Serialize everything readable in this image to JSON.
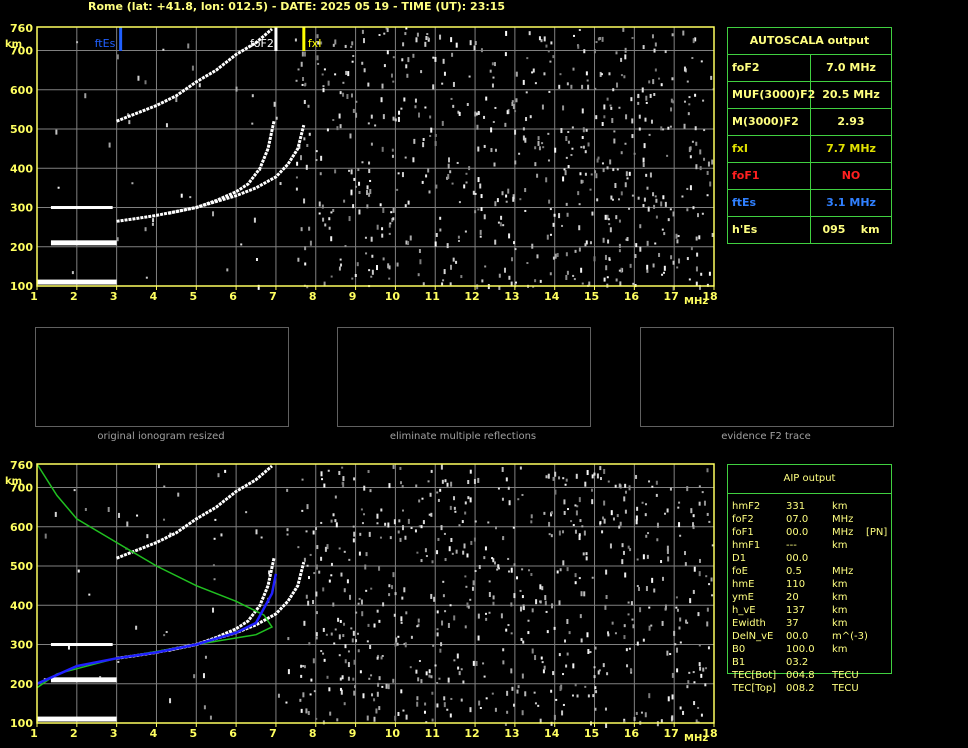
{
  "title": "Rome (lat: +41.8, lon: 012.5) - DATE: 2025 05 19 - TIME (UT): 23:15",
  "colors": {
    "axis": "#ffff60",
    "grid": "#808080",
    "ftEs": "#2060ff",
    "fxI": "#ffff00",
    "foF2": "#ffffff",
    "profile": "#20c020",
    "trace": "#2020ff",
    "foF1": "#ff2020"
  },
  "autoscala": {
    "header": "AUTOSCALA output",
    "rows": [
      {
        "k": "foF2",
        "v": "7.0 MHz",
        "c": "#ffff80"
      },
      {
        "k": "MUF(3000)F2",
        "v": "20.5 MHz",
        "c": "#ffff80"
      },
      {
        "k": "M(3000)F2",
        "v": "2.93",
        "c": "#ffff80"
      },
      {
        "k": "fxI",
        "v": "7.7 MHz",
        "c": "#e0e000"
      },
      {
        "k": "foF1",
        "v": "NO",
        "c": "#ff2020"
      },
      {
        "k": "ftEs",
        "v": "3.1 MHz",
        "c": "#3080ff"
      },
      {
        "k": "h'Es",
        "v": "095    km",
        "c": "#ffff80"
      }
    ]
  },
  "aip": {
    "header": "AIP output",
    "rows": [
      [
        "hmF2",
        "331",
        "km",
        ""
      ],
      [
        "foF2",
        "07.0",
        "MHz",
        ""
      ],
      [
        "foF1",
        "00.0",
        "MHz",
        "[PN]"
      ],
      [
        "hmF1",
        "---",
        "km",
        ""
      ],
      [
        "D1",
        "00.0",
        "",
        ""
      ],
      [
        "foE",
        "0.5",
        "MHz",
        ""
      ],
      [
        "hmE",
        "110",
        "km",
        ""
      ],
      [
        "ymE",
        "20",
        "km",
        ""
      ],
      [
        "h_vE",
        "137",
        "km",
        ""
      ],
      [
        "Ewidth",
        "37",
        "km",
        ""
      ],
      [
        "DelN_vE",
        "00.0",
        "m^(-3)",
        ""
      ],
      [
        "B0",
        "100.0",
        "km",
        ""
      ],
      [
        "B1",
        "03.2",
        "",
        ""
      ],
      [
        "TEC[Bot]",
        "004.8",
        "TECU",
        ""
      ],
      [
        "TEC[Top]",
        "008.2",
        "TECU",
        ""
      ]
    ]
  },
  "captions": [
    "original ionogram resized",
    "eliminate multiple reflections",
    "evidence F2 trace"
  ],
  "chart_data": [
    {
      "type": "scatter",
      "title": "",
      "xlabel": "MHz",
      "ylabel": "km",
      "xlim": [
        1,
        18
      ],
      "ylim": [
        100,
        760
      ],
      "xticks": [
        "1",
        "2",
        "3",
        "4",
        "5",
        "6",
        "7",
        "8",
        "9",
        "10",
        "11",
        "12",
        "13",
        "14",
        "15",
        "16",
        "17",
        "18"
      ],
      "yticks": [
        "100",
        "200",
        "300",
        "400",
        "500",
        "600",
        "700",
        "760"
      ],
      "markers": [
        {
          "name": "ftEs",
          "x": 3.1
        },
        {
          "name": "foF2",
          "x": 7.0
        },
        {
          "name": "fxI",
          "x": 7.7
        }
      ],
      "grid": true
    },
    {
      "type": "scatter",
      "title": "",
      "xlabel": "MHz",
      "ylabel": "km",
      "xlim": [
        1,
        18
      ],
      "ylim": [
        100,
        760
      ],
      "xticks": [
        "1",
        "2",
        "3",
        "4",
        "5",
        "6",
        "7",
        "8",
        "9",
        "10",
        "11",
        "12",
        "13",
        "14",
        "15",
        "16",
        "17",
        "18"
      ],
      "yticks": [
        "100",
        "200",
        "300",
        "400",
        "500",
        "600",
        "700",
        "760"
      ],
      "grid": true
    }
  ]
}
